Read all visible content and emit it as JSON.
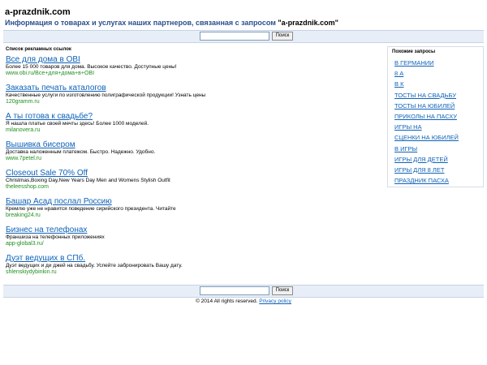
{
  "header": {
    "site_title": "a-prazdnik.com",
    "subtitle_prefix": "Информация о товарах и услугах наших партнеров, связанная с запросом ",
    "subtitle_query": "\"a-prazdnik.com\""
  },
  "search": {
    "input_value": "",
    "button_label": "Поиск"
  },
  "ads": {
    "heading": "Список рекламных ссылок",
    "items": [
      {
        "title": "Все для дома в OBI",
        "desc": "Более 15 000 товаров для дома. Высокое качество. Доступные цены!",
        "url": "www.obi.ru/Все+для+дома+в+OBI"
      },
      {
        "title": "Заказать печать каталогов",
        "desc": "Качественные услуги по изготовлению полиграфической продукции! Узнать цены",
        "url": "120gramm.ru"
      },
      {
        "title": "А ты готова к свадьбе?",
        "desc": "Я нашла платье своей мечты здесь! Более 1000 моделей.",
        "url": "milanovera.ru"
      },
      {
        "title": "Вышивка бисером",
        "desc": "Доставка наложенным платежом. Быстро. Надежно. Удобно.",
        "url": "www.7petel.ru"
      },
      {
        "title": "Closeout Sale 70% Off",
        "desc": "Christmas,Boxing Day,New Years Day Men and Womens Stylish Outfit",
        "url": "theleesshop.com"
      },
      {
        "title": "Башар Асад послал Россию",
        "desc": "Кремлю уже не нравится поведение сирийского президента. Читайте",
        "url": "breaking24.ru"
      },
      {
        "title": "Бизнес на телефонах",
        "desc": "Франшиза на телефонных приложениях",
        "url": "app-global3.ru/"
      },
      {
        "title": "Дуэт ведущих в СПб.",
        "desc": "Дуэт ведущих и ди джей на свадьбу. Успейте забронировать Вашу дату.",
        "url": "shlenskiydybinkin.ru"
      }
    ]
  },
  "related": {
    "heading": "Похожие запросы",
    "items": [
      "В ГЕРМАНИИ",
      "8 А",
      "В К",
      "ТОСТЫ НА СВАДЬБУ",
      "ТОСТЫ НА ЮБИЛЕЙ",
      "ПРИКОЛЫ НА ПАСХУ",
      "ИГРЫ НА",
      "СЦЕНКИ НА ЮБИЛЕЙ",
      "В ИГРЫ",
      "ИГРЫ ДЛЯ ДЕТЕЙ",
      "ИГРЫ ДЛЯ 8 ЛЕТ",
      "ПРАЗДНИК ПАСХА"
    ]
  },
  "footer": {
    "copyright": "© 2014 All rights reserved.",
    "privacy_label": "Privacy policy"
  },
  "colors": {
    "link": "#0e62b8",
    "url": "#1f8f1f",
    "subtitle": "#2b4f8f",
    "search_bar": "#e8eef7"
  }
}
